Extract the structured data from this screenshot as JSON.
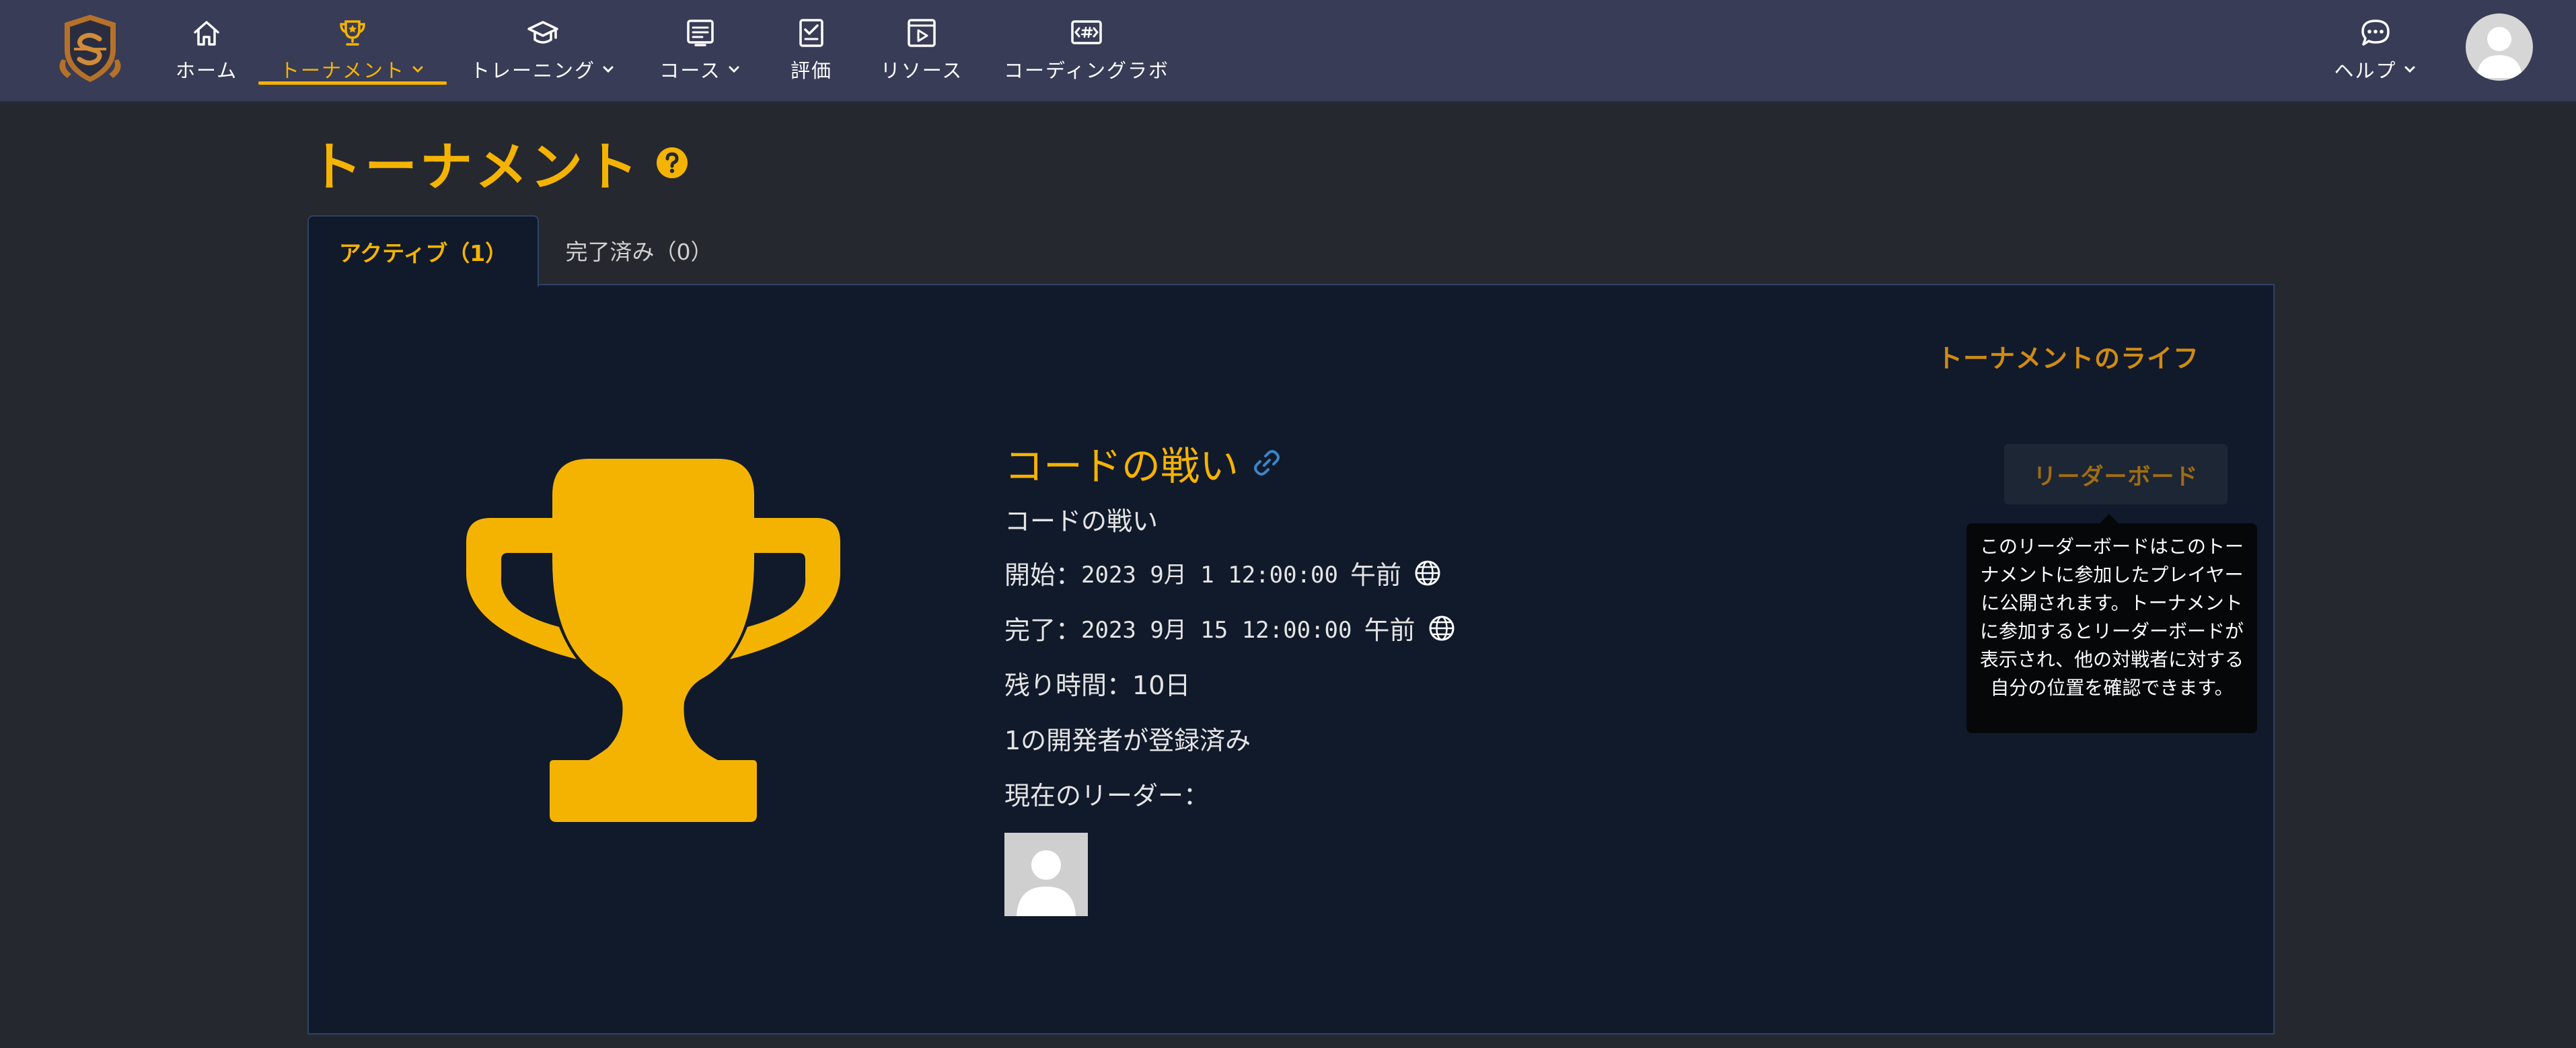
{
  "nav": {
    "items": [
      {
        "label": "ホーム",
        "icon": "home-icon"
      },
      {
        "label": "トーナメント",
        "icon": "trophy-icon"
      },
      {
        "label": "トレーニング",
        "icon": "graduation-cap-icon"
      },
      {
        "label": "コース",
        "icon": "course-icon"
      },
      {
        "label": "評価",
        "icon": "assessment-icon"
      },
      {
        "label": "リソース",
        "icon": "resource-icon"
      },
      {
        "label": "コーディングラボ",
        "icon": "code-lab-icon"
      }
    ],
    "help": {
      "label": "ヘルプ",
      "icon": "chat-icon"
    }
  },
  "page": {
    "title": "トーナメント"
  },
  "tabs": {
    "active": "アクティブ（1）",
    "completed": "完了済み（0）"
  },
  "tournament": {
    "life_label": "トーナメントのライフ",
    "title": "コードの戦い",
    "subtitle": "コードの戦い",
    "start_label": "開始：",
    "start_date": "2023 9月 1 12:00:00",
    "start_ampm": "午前",
    "end_label": "完了：",
    "end_date": "2023 9月 15 12:00:00",
    "end_ampm": "午前",
    "remaining_label": "残り時間：",
    "remaining_value": "10日",
    "registered": "1の開発者が登録済み",
    "leader_label": "現在のリーダー："
  },
  "leaderboard": {
    "button_label": "リーダーボード",
    "tooltip": "このリーダーボードはこのトーナメントに参加したプレイヤーに公開されます。トーナメントに参加するとリーダーボードが表示され、他の対戦者に対する自分の位置を確認できます。"
  },
  "colors": {
    "accent": "#f5b301",
    "nav_bg": "#383c56",
    "page_bg": "#25282e",
    "panel_bg": "#111a2b",
    "panel_border": "#2d4465",
    "link_blue": "#3b86c8"
  }
}
